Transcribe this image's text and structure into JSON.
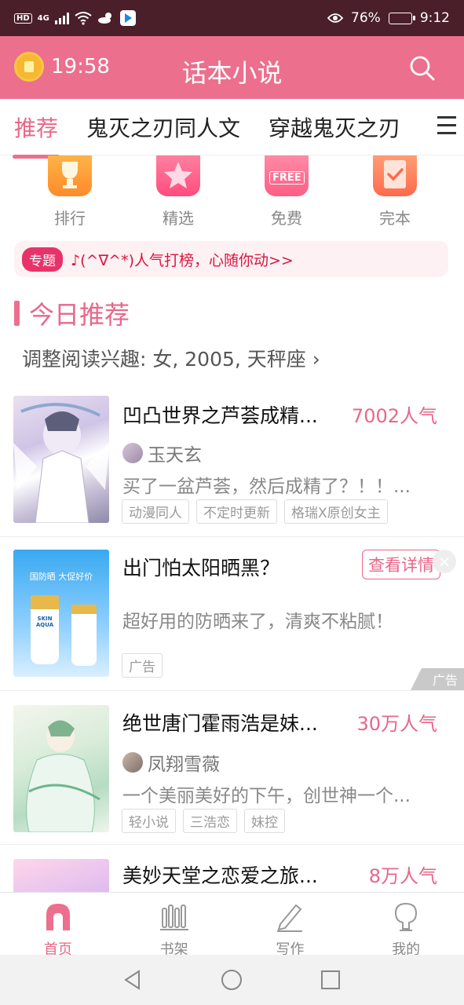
{
  "status_bar": {
    "hd": "HD",
    "network": "4G",
    "battery": "76%",
    "battery_level": 0.76,
    "time": "9:12"
  },
  "header": {
    "clock": "19:58",
    "title": "话本小说"
  },
  "tabs": [
    {
      "label": "推荐",
      "active": true
    },
    {
      "label": "鬼灭之刃同人文",
      "active": false
    },
    {
      "label": "穿越鬼灭之刃",
      "active": false
    }
  ],
  "quick_entries": [
    {
      "label": "排行",
      "icon": "trophy-icon"
    },
    {
      "label": "精选",
      "icon": "star-icon"
    },
    {
      "label": "免费",
      "icon": "free-icon",
      "icon_text": "FREE"
    },
    {
      "label": "完本",
      "icon": "check-icon"
    }
  ],
  "topic": {
    "badge": "专题",
    "text": "♪(^∇^*)人气打榜，心随你动>>"
  },
  "section": {
    "title": "今日推荐",
    "interest": "调整阅读兴趣: 女, 2005, 天秤座 ›"
  },
  "books": [
    {
      "title": "凹凸世界之芦荟成精...",
      "popularity": "7002人气",
      "author": "玉天玄",
      "description": "买了一盆芦荟，然后成精了？！！...",
      "tags": [
        "动漫同人",
        "不定时更新",
        "格瑞X原创女主"
      ]
    },
    {
      "title": "绝世唐门霍雨浩是妹...",
      "popularity": "30万人气",
      "author": "凤翔雪薇",
      "description": "一个美丽美好的下午，创世神一个...",
      "tags": [
        "轻小说",
        "三浩恋",
        "妹控"
      ]
    },
    {
      "title": "美妙天堂之恋爱之旅...",
      "popularity": "8万人气"
    }
  ],
  "ad": {
    "title": "出门怕太阳晒黑？",
    "detail_button": "查看详情",
    "description": "超好用的防晒来了，清爽不粘腻！",
    "tag": "广告",
    "mark": "广告",
    "cover_text_1": "国防晒 大促好价",
    "cover_brand": "SKIN AQUA"
  },
  "bottom_nav": [
    {
      "label": "首页",
      "active": true
    },
    {
      "label": "书架",
      "active": false
    },
    {
      "label": "写作",
      "active": false
    },
    {
      "label": "我的",
      "active": false
    }
  ],
  "colors": {
    "accent": "#ec6f8d",
    "status_bar": "#4a1f2a",
    "topic_text": "#d9163f"
  }
}
